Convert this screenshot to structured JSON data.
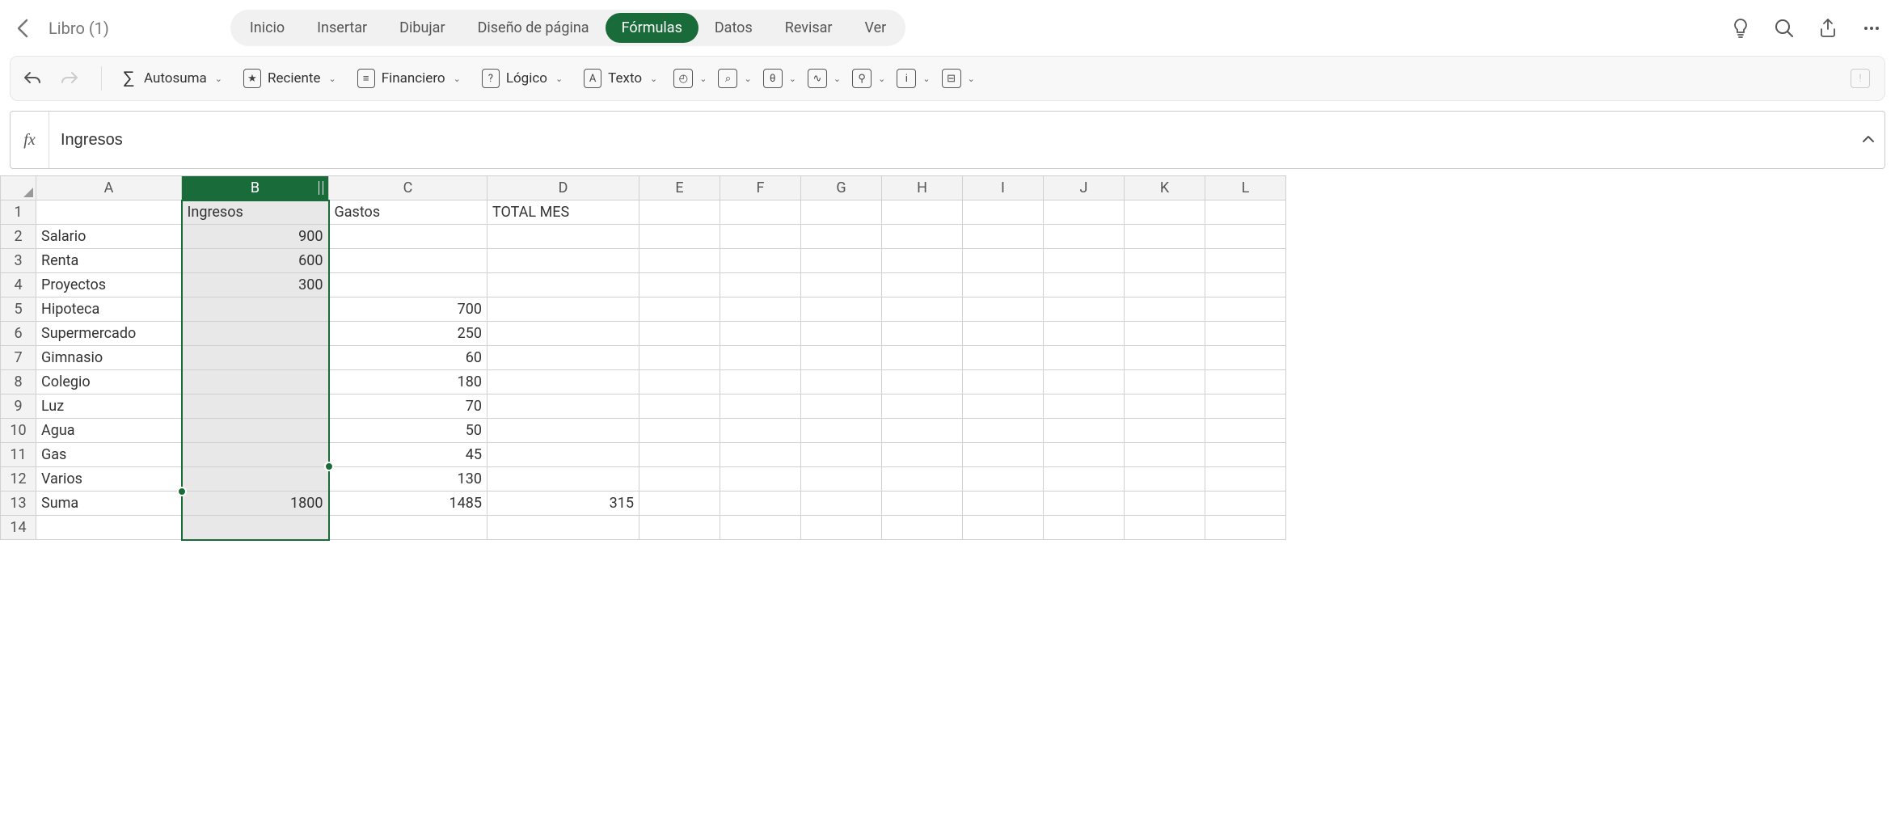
{
  "title": "Libro (1)",
  "tabs": [
    {
      "label": "Inicio",
      "active": false
    },
    {
      "label": "Insertar",
      "active": false
    },
    {
      "label": "Dibujar",
      "active": false
    },
    {
      "label": "Diseño de página",
      "active": false
    },
    {
      "label": "Fórmulas",
      "active": true
    },
    {
      "label": "Datos",
      "active": false
    },
    {
      "label": "Revisar",
      "active": false
    },
    {
      "label": "Ver",
      "active": false
    }
  ],
  "ribbon": {
    "autosum": "Autosuma",
    "recent": "Reciente",
    "financial": "Financiero",
    "logical": "Lógico",
    "text": "Texto"
  },
  "formula_bar": {
    "fx_label": "fx",
    "value": "Ingresos"
  },
  "columns": [
    "A",
    "B",
    "C",
    "D",
    "E",
    "F",
    "G",
    "H",
    "I",
    "J",
    "K",
    "L"
  ],
  "selected_column": "B",
  "rows": [
    {
      "n": 1,
      "A": "",
      "B": "Ingresos",
      "C": "Gastos",
      "D": "TOTAL MES"
    },
    {
      "n": 2,
      "A": "Salario",
      "B": "900",
      "C": "",
      "D": ""
    },
    {
      "n": 3,
      "A": "Renta",
      "B": "600",
      "C": "",
      "D": ""
    },
    {
      "n": 4,
      "A": "Proyectos",
      "B": "300",
      "C": "",
      "D": ""
    },
    {
      "n": 5,
      "A": "Hipoteca",
      "B": "",
      "C": "700",
      "D": ""
    },
    {
      "n": 6,
      "A": "Supermercado",
      "B": "",
      "C": "250",
      "D": ""
    },
    {
      "n": 7,
      "A": "Gimnasio",
      "B": "",
      "C": "60",
      "D": ""
    },
    {
      "n": 8,
      "A": "Colegio",
      "B": "",
      "C": "180",
      "D": ""
    },
    {
      "n": 9,
      "A": "Luz",
      "B": "",
      "C": "70",
      "D": ""
    },
    {
      "n": 10,
      "A": "Agua",
      "B": "",
      "C": "50",
      "D": ""
    },
    {
      "n": 11,
      "A": "Gas",
      "B": "",
      "C": "45",
      "D": ""
    },
    {
      "n": 12,
      "A": "Varios",
      "B": "",
      "C": "130",
      "D": ""
    },
    {
      "n": 13,
      "A": "Suma",
      "B": "1800",
      "C": "1485",
      "D": "315"
    },
    {
      "n": 14,
      "A": "",
      "B": "",
      "C": "",
      "D": ""
    }
  ]
}
